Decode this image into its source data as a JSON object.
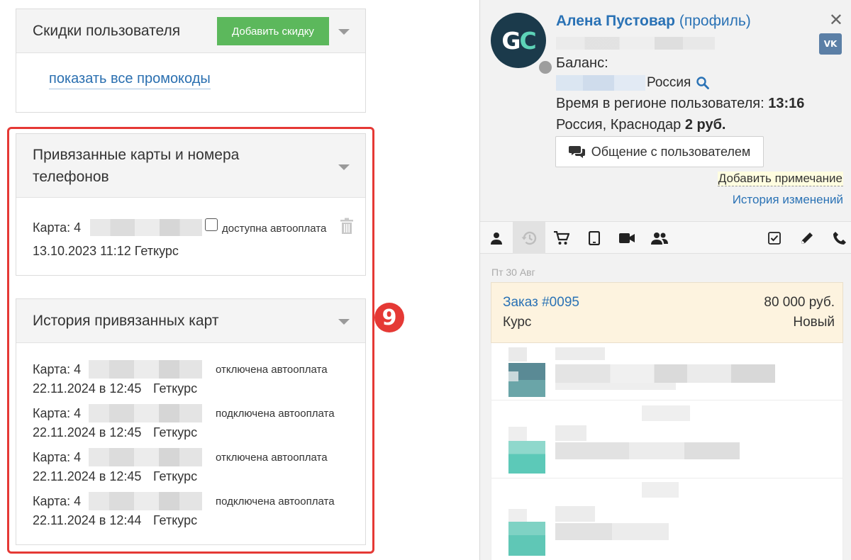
{
  "discounts": {
    "title": "Скидки пользователя",
    "add_button": "Добавить скидку",
    "show_promos_link": "показать все промокоды"
  },
  "cards": {
    "title": "Привязанные карты и номера телефонов",
    "card_prefix": "Карта: 4",
    "autopay_label": "доступна автооплата",
    "date_line": "13.10.2023 11:12 Геткурс"
  },
  "card_history": {
    "title": "История привязанных карт",
    "rows": [
      {
        "card": "Карта: 4",
        "status": "отключена автооплата",
        "date": "22.11.2024 в 12:45",
        "source": "Геткурс"
      },
      {
        "card": "Карта: 4",
        "status": "подключена автооплата",
        "date": "22.11.2024 в 12:45",
        "source": "Геткурс"
      },
      {
        "card": "Карта: 4",
        "status": "отключена автооплата",
        "date": "22.11.2024 в 12:45",
        "source": "Геткурс"
      },
      {
        "card": "Карта: 4",
        "status": "подключена автооплата",
        "date": "22.11.2024 в 12:44",
        "source": "Геткурс"
      }
    ]
  },
  "annotation_badge": "9",
  "user": {
    "avatar_initials_1": "G",
    "avatar_initials_2": "C",
    "name": "Алена Пустовар",
    "profile_link": "(профиль)",
    "balance_label": "Баланс:",
    "country_suffix": "Россия",
    "region_time_label": "Время в регионе пользователя:",
    "region_time_value": "13:16",
    "location": "Россия, Краснодар",
    "location_price": "2 руб.",
    "chat_button": "Общение с пользователем",
    "add_note": "Добавить примечание",
    "history_link": "История изменений",
    "vk_label": "VK"
  },
  "tabs": [
    "user-icon",
    "history-icon",
    "cart-icon",
    "tablet-icon",
    "video-icon",
    "group-icon",
    "checkbox-icon",
    "pencil-icon",
    "phone-icon"
  ],
  "feed": {
    "date_label": "Пт 30 Авг",
    "order": {
      "title": "Заказ #0095",
      "amount": "80 000 руб.",
      "type": "Курс",
      "status": "Новый"
    }
  },
  "colors": {
    "accent_blue": "#2a72b5",
    "green_button": "#5cb85c",
    "highlight_red": "#e53935",
    "order_bg": "#fdf3df",
    "avatar_bg": "#1b3a4b",
    "avatar_teal": "#5dd3b8"
  }
}
